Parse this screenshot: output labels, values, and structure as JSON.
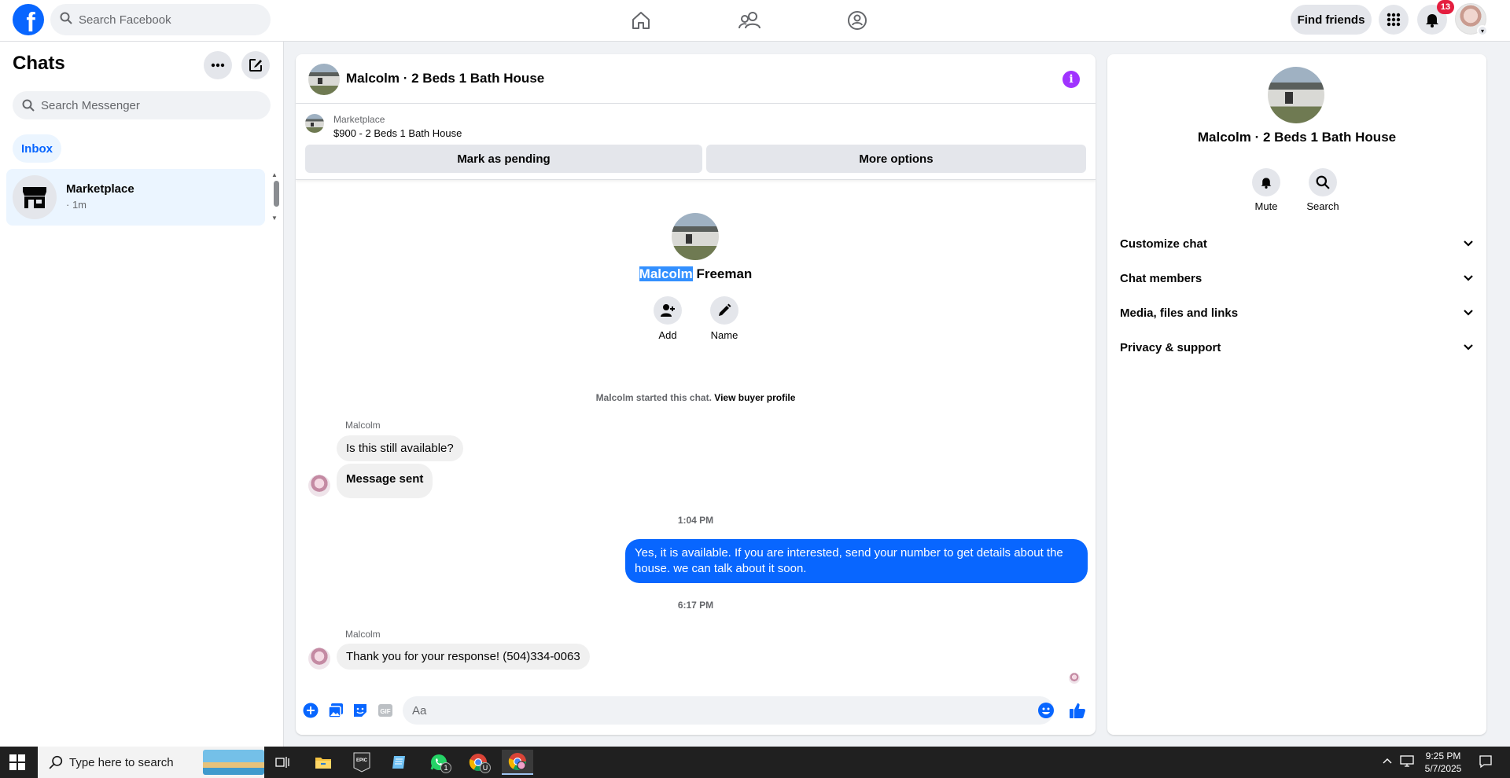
{
  "topbar": {
    "logo_letter": "f",
    "search_placeholder": "Search Facebook",
    "find_friends_label": "Find friends",
    "notification_count": "13"
  },
  "sidebar": {
    "title": "Chats",
    "search_placeholder": "Search Messenger",
    "filter_label": "Inbox",
    "conversations": [
      {
        "name": "Marketplace",
        "time": "· 1m"
      }
    ]
  },
  "chat": {
    "header_title": "Malcolm · 2 Beds 1 Bath House",
    "marketplace": {
      "label": "Marketplace",
      "listing": "$900 - 2 Beds 1 Bath House",
      "mark_pending_label": "Mark as pending",
      "more_options_label": "More options"
    },
    "profile": {
      "first_name": "Malcolm",
      "last_name": "Freeman",
      "add_label": "Add",
      "name_label": "Name"
    },
    "system_line": {
      "text": "Malcolm started this chat.",
      "link": "View buyer profile"
    },
    "messages": [
      {
        "sender": "Malcolm",
        "text": "Is this still available?"
      },
      {
        "text": "Message sent"
      },
      {
        "timestamp": "1:04 PM"
      },
      {
        "text": "Yes, it is available. If you are interested, send your number to get details about the house. we can talk about it soon."
      },
      {
        "timestamp": "6:17 PM"
      },
      {
        "sender": "Malcolm",
        "text": "Thank you for your response! (504)334-0063"
      }
    ],
    "composer_placeholder": "Aa",
    "gif_label": "GIF"
  },
  "right_panel": {
    "name": "Malcolm · 2 Beds 1 Bath House",
    "mute_label": "Mute",
    "search_label": "Search",
    "sections": [
      "Customize chat",
      "Chat members",
      "Media, files and links",
      "Privacy & support"
    ]
  },
  "taskbar": {
    "search_placeholder": "Type here to search",
    "time": "9:25 PM",
    "date": "5/7/2025",
    "whatsapp_badge": "1",
    "chrome_badge": "U",
    "epic_label": "EPIC"
  },
  "colors": {
    "brand_blue": "#0866ff",
    "badge_red": "#e41e3f",
    "info_purple": "#a033ff",
    "selection_blue": "#3390ff"
  }
}
